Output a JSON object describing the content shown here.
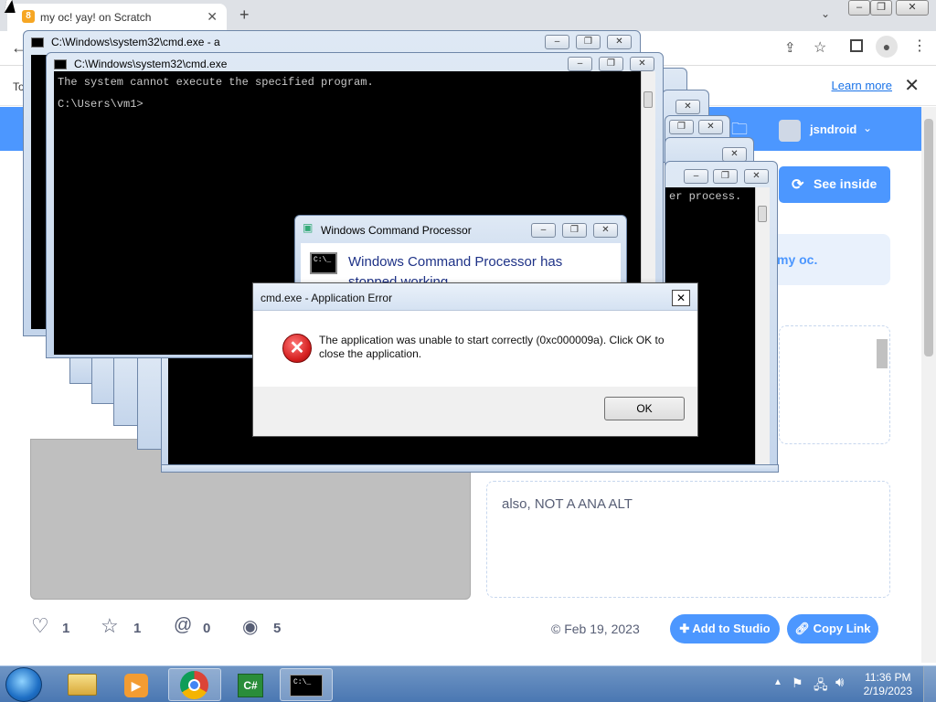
{
  "browser": {
    "tab_title": "my oc! yay! on Scratch",
    "new_tab": "+",
    "close_tab": "✕",
    "infobar_learn_more": "Learn more",
    "infobar_prefix": "To"
  },
  "scratch": {
    "username": "jsndroid",
    "see_inside": "See inside",
    "notes_snippet": "my oc.",
    "notes_text": "also, NOT A ANA ALT",
    "stats": {
      "loves": "1",
      "favorites": "1",
      "remixes": "0",
      "views": "5"
    },
    "date": "Feb 19, 2023",
    "add_to_studio": "Add to Studio",
    "copy_link": "Copy Link"
  },
  "cmd_windows": {
    "back_title": "C:\\Windows\\system32\\cmd.exe - a",
    "front_title": "C:\\Windows\\system32\\cmd.exe",
    "line1": "The system cannot execute the specified program.",
    "line2": "C:\\Users\\vm1>",
    "right_fragment": "er process."
  },
  "wcp_dialog": {
    "title": "Windows Command Processor",
    "heading": "Windows Command Processor has stopped working"
  },
  "error_dialog": {
    "title": "cmd.exe - Application Error",
    "message": "The application was unable to start correctly (0xc000009a). Click OK to close the application.",
    "ok": "OK",
    "close": "✕"
  },
  "taskbar": {
    "time": "11:36 PM",
    "date": "2/19/2023",
    "cmd_icon_text": "C:\\_",
    "csharp_icon_text": "C#"
  },
  "colors": {
    "scratch_blue": "#4c97ff",
    "taskbar_blue": "#4a77b2",
    "error_red": "#d41e1e"
  }
}
